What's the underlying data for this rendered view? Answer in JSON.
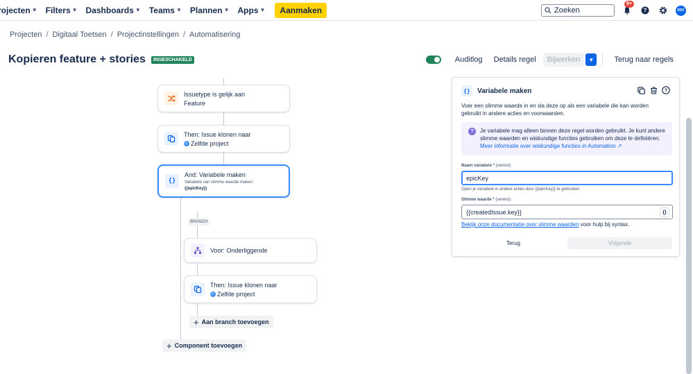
{
  "nav": {
    "items": [
      {
        "label": "rojecten"
      },
      {
        "label": "Filters"
      },
      {
        "label": "Dashboards"
      },
      {
        "label": "Teams"
      },
      {
        "label": "Plannen"
      },
      {
        "label": "Apps"
      }
    ],
    "create_label": "Aanmaken",
    "search_placeholder": "Zoeken",
    "notification_count": "9+",
    "avatar_initials": "DSV",
    "accent": "#ffd200"
  },
  "breadcrumb": [
    "Projecten",
    "Digitaal Toetsen",
    "Projectinstellingen",
    "Automatisering"
  ],
  "rule": {
    "title": "Kopieren feature + stories",
    "status": "INGESCHAKELD",
    "actions": {
      "audit_log": "Auditlog",
      "rule_details": "Details regel",
      "update": "Bijwerken",
      "back_to_rules": "Terug naar regels"
    }
  },
  "flow": {
    "trigger": {
      "title": "Issuetype is gelijk aan",
      "value": "Feature",
      "icon": "shuffle-icon"
    },
    "clone1": {
      "title": "Then: Issue klonen naar",
      "value": "Zelfde project",
      "icon": "copy-icon"
    },
    "variable": {
      "title": "And: Variabele maken",
      "sub": "Variabele van slimme waarde maken",
      "value": "{{epicKey}}",
      "icon": "braces-icon"
    },
    "branch_tag": "BRANCH",
    "branch_for": {
      "title": "Voor: Onderliggende",
      "icon": "hierarchy-icon"
    },
    "clone2": {
      "title": "Then: Issue klonen naar",
      "value": "Zelfde project",
      "icon": "copy-icon"
    },
    "add_branch": "Aan branch toevoegen",
    "add_component": "Component toevoegen"
  },
  "panel": {
    "title": "Variabele maken",
    "description": "Voer een slimme waarde in en sla deze op als een variabele die kan worden gebruikt in andere acties en voorwaarden.",
    "info_text": "Je variabele mag alleen binnen deze regel worden gebruikt. Je kunt andere slimme waarden en wiskundige functies gebruiken om deze te definiëren.",
    "info_link": "Meer informatie over wiskundige functies in Automation ↗",
    "name_label": "Naam variabele *",
    "name_required": "(vereist)",
    "name_value": "epicKey",
    "name_hint": "Open je variabele in andere acties door {{epicKey}} te gebruiken",
    "smart_label": "Slimme waarde *",
    "smart_required": "(vereist)",
    "smart_value": "{{createdIssue.key}}",
    "brace_button": "{}",
    "help_link": "Bekijk onze documentatie over slimme waarden",
    "help_suffix": " voor hulp bij syntax.",
    "back": "Terug",
    "next": "Volgende"
  }
}
